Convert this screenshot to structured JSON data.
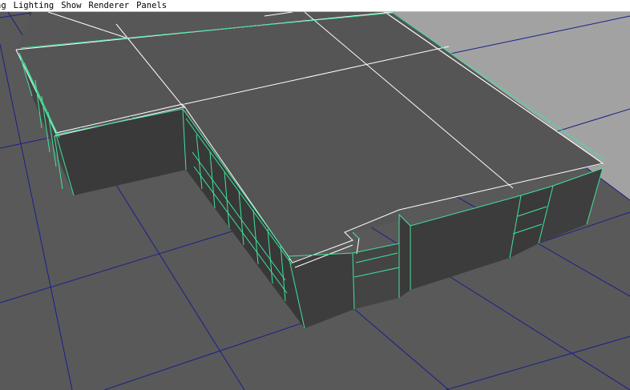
{
  "menubar": {
    "items": [
      {
        "label": "ng"
      },
      {
        "label": "Lighting"
      },
      {
        "label": "Show"
      },
      {
        "label": "Renderer"
      },
      {
        "label": "Panels"
      }
    ]
  },
  "viewport": {
    "colors": {
      "grid_floor": "#595959",
      "grid_line": "#1a1f8a",
      "background": "#a2a2a2",
      "roof": "#555555",
      "wall_dark": "#3c3c3c",
      "wall_mid": "#444444",
      "edge_selected": "#3fe39a",
      "edge_roof": "#ffffff"
    }
  }
}
